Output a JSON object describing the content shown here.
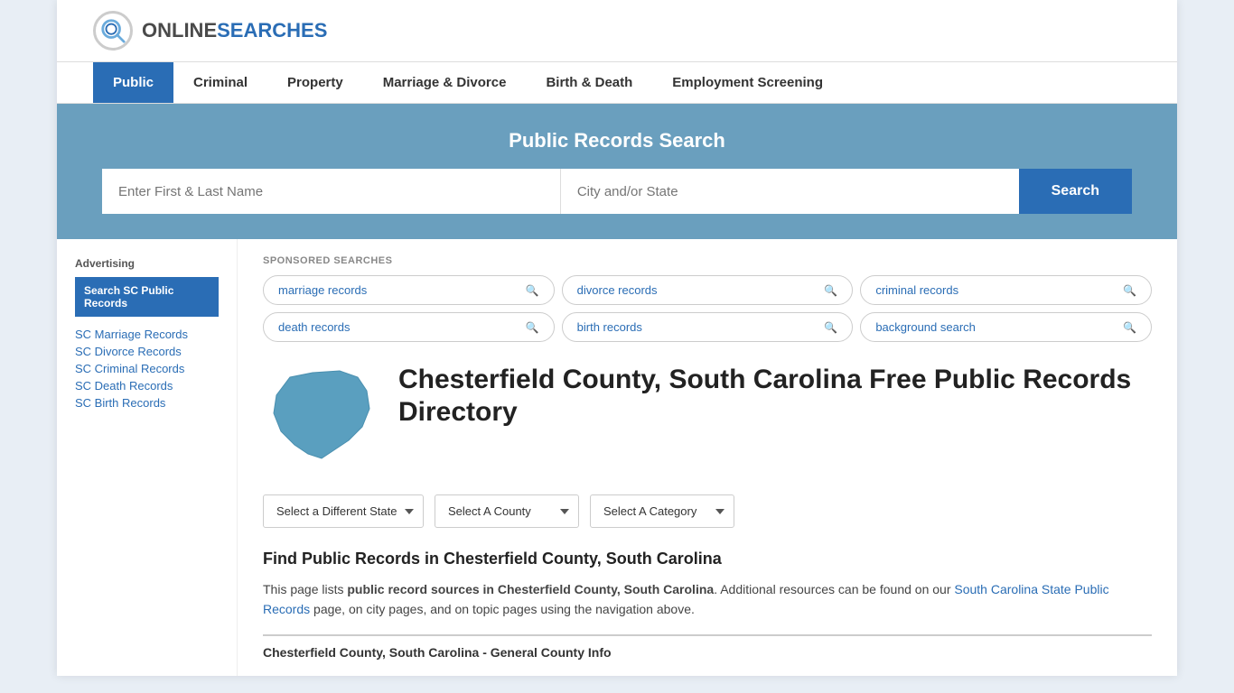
{
  "site": {
    "logo_online": "ONLINE",
    "logo_searches": "SEARCHES"
  },
  "nav": {
    "items": [
      {
        "label": "Public",
        "active": true
      },
      {
        "label": "Criminal",
        "active": false
      },
      {
        "label": "Property",
        "active": false
      },
      {
        "label": "Marriage & Divorce",
        "active": false
      },
      {
        "label": "Birth & Death",
        "active": false
      },
      {
        "label": "Employment Screening",
        "active": false
      }
    ]
  },
  "search_section": {
    "title": "Public Records Search",
    "name_placeholder": "Enter First & Last Name",
    "location_placeholder": "City and/or State",
    "button_label": "Search"
  },
  "sponsored": {
    "label": "SPONSORED SEARCHES",
    "tags": [
      "marriage records",
      "divorce records",
      "criminal records",
      "death records",
      "birth records",
      "background search"
    ]
  },
  "county": {
    "title": "Chesterfield County, South Carolina Free Public Records Directory",
    "dropdowns": {
      "state": "Select a Different State",
      "county": "Select A County",
      "category": "Select A Category"
    }
  },
  "find_section": {
    "title": "Find Public Records in Chesterfield County, South Carolina",
    "text_before": "This page lists ",
    "text_bold": "public record sources in Chesterfield County, South Carolina",
    "text_after": ". Additional resources can be found on our ",
    "link_text": "South Carolina State Public Records",
    "text_end": " page, on city pages, and on topic pages using the navigation above."
  },
  "general_info": {
    "title": "Chesterfield County, South Carolina - General County Info"
  },
  "sidebar": {
    "advertising_label": "Advertising",
    "ad_box_label": "Search SC Public Records",
    "links": [
      "SC Marriage Records",
      "SC Divorce Records",
      "SC Criminal Records",
      "SC Death Records",
      "SC Birth Records"
    ]
  }
}
